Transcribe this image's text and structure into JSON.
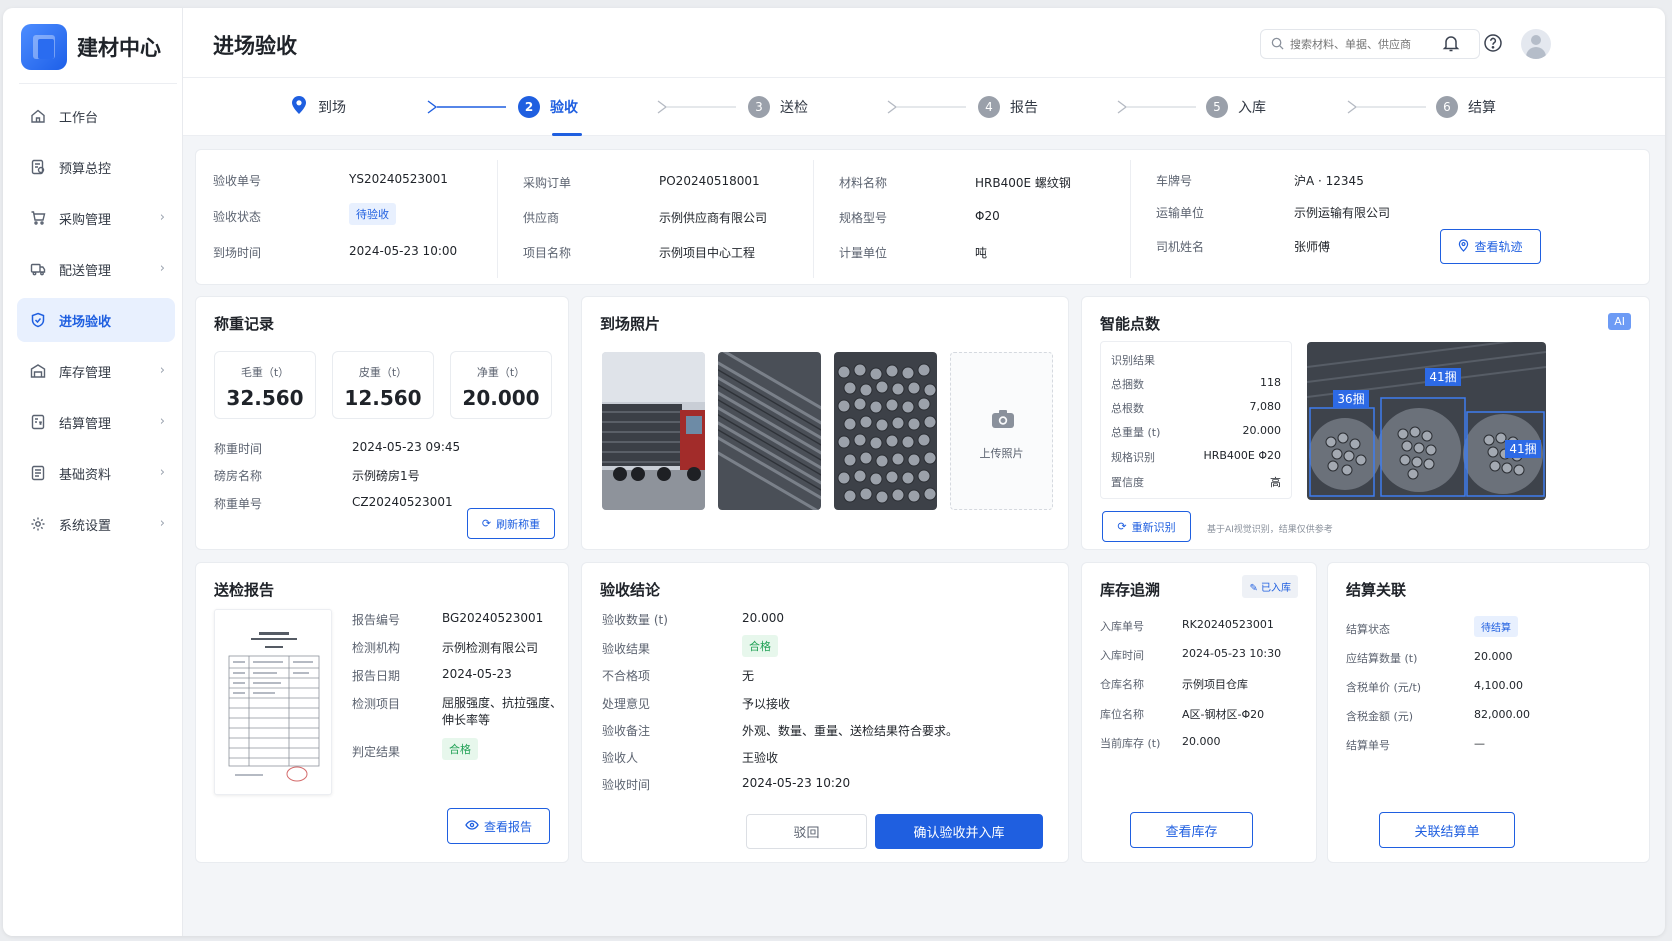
{
  "app": {
    "name": "建材中心"
  },
  "sidebar": {
    "items": [
      {
        "label": "工作台",
        "icon": "home-icon"
      },
      {
        "label": "预算总控",
        "icon": "budget-icon"
      },
      {
        "label": "采购管理",
        "icon": "cart-icon"
      },
      {
        "label": "配送管理",
        "icon": "truck-icon"
      },
      {
        "label": "进场验收",
        "icon": "shield-check-icon"
      },
      {
        "label": "库存管理",
        "icon": "warehouse-icon"
      },
      {
        "label": "结算管理",
        "icon": "settlement-icon"
      },
      {
        "label": "基础资料",
        "icon": "document-icon"
      },
      {
        "label": "系统设置",
        "icon": "gear-icon"
      }
    ]
  },
  "header": {
    "title": "进场验收",
    "search_placeholder": "搜索材料、单据、供应商"
  },
  "steps": [
    {
      "num": "",
      "label": "到场"
    },
    {
      "num": "2",
      "label": "验收"
    },
    {
      "num": "3",
      "label": "送检"
    },
    {
      "num": "4",
      "label": "报告"
    },
    {
      "num": "5",
      "label": "入库"
    },
    {
      "num": "6",
      "label": "结算"
    }
  ],
  "summary": {
    "col1": [
      {
        "k": "验收单号",
        "v": "YS20240523001"
      },
      {
        "k": "验收状态",
        "v": "待验收"
      },
      {
        "k": "到场时间",
        "v": "2024-05-23 10:00"
      }
    ],
    "col2": [
      {
        "k": "采购订单",
        "v": "PO20240518001"
      },
      {
        "k": "供应商",
        "v": "示例供应商有限公司"
      },
      {
        "k": "项目名称",
        "v": "示例项目中心工程"
      }
    ],
    "col3": [
      {
        "k": "材料名称",
        "v": "HRB400E 螺纹钢"
      },
      {
        "k": "规格型号",
        "v": "Φ20"
      },
      {
        "k": "计量单位",
        "v": "吨"
      }
    ],
    "col4": [
      {
        "k": "车牌号",
        "v": "沪A · 12345"
      },
      {
        "k": "运输单位",
        "v": "示例运输有限公司"
      },
      {
        "k": "司机姓名",
        "v": "张师傅"
      }
    ],
    "track_button": "查看轨迹"
  },
  "weighing": {
    "title": "称重记录",
    "boxes": [
      {
        "label": "毛重（t）",
        "value": "32.560"
      },
      {
        "label": "皮重（t）",
        "value": "12.560"
      },
      {
        "label": "净重（t）",
        "value": "20.000"
      }
    ],
    "rows": [
      {
        "k": "称重时间",
        "v": "2024-05-23 09:45"
      },
      {
        "k": "磅房名称",
        "v": "示例磅房1号"
      },
      {
        "k": "称重单号",
        "v": "CZ20240523001"
      }
    ],
    "refresh_button": "刷新称重"
  },
  "photos": {
    "title": "到场照片",
    "upload_label": "上传照片"
  },
  "ai_count": {
    "title": "智能点数",
    "badge": "AI",
    "result_title": "识别结果",
    "rows": [
      {
        "k": "总捆数",
        "v": "118"
      },
      {
        "k": "总根数",
        "v": "7,080"
      },
      {
        "k": "总重量 (t)",
        "v": "20.000"
      },
      {
        "k": "规格识别",
        "v": "HRB400E Φ20"
      },
      {
        "k": "置信度",
        "v": "高"
      }
    ],
    "boxes": [
      "36捆",
      "41捆",
      "41捆"
    ],
    "rerun_button": "重新识别",
    "note": "基于AI视觉识别，结果仅供参考"
  },
  "report": {
    "title": "送检报告",
    "rows": [
      {
        "k": "报告编号",
        "v": "BG20240523001"
      },
      {
        "k": "检测机构",
        "v": "示例检测有限公司"
      },
      {
        "k": "报告日期",
        "v": "2024-05-23"
      },
      {
        "k": "检测项目",
        "v": "屈服强度、抗拉强度、伸长率等"
      },
      {
        "k": "判定结果",
        "v": "合格"
      }
    ],
    "view_button": "查看报告"
  },
  "conclusion": {
    "title": "验收结论",
    "rows": [
      {
        "k": "验收数量 (t)",
        "v": "20.000"
      },
      {
        "k": "验收结果",
        "v": "合格"
      },
      {
        "k": "不合格项",
        "v": "无"
      },
      {
        "k": "处理意见",
        "v": "予以接收"
      },
      {
        "k": "验收备注",
        "v": "外观、数量、重量、送检结果符合要求。"
      },
      {
        "k": "验收人",
        "v": "王验收"
      },
      {
        "k": "验收时间",
        "v": "2024-05-23 10:20"
      }
    ],
    "reject_button": "驳回",
    "confirm_button": "确认验收并入库"
  },
  "inventory": {
    "title": "库存追溯",
    "badge": "已入库",
    "rows": [
      {
        "k": "入库单号",
        "v": "RK20240523001"
      },
      {
        "k": "入库时间",
        "v": "2024-05-23 10:30"
      },
      {
        "k": "仓库名称",
        "v": "示例项目仓库"
      },
      {
        "k": "库位名称",
        "v": "A区-钢材区-Φ20"
      },
      {
        "k": "当前库存 (t)",
        "v": "20.000"
      }
    ],
    "view_button": "查看库存"
  },
  "settlement": {
    "title": "结算关联",
    "rows": [
      {
        "k": "结算状态",
        "v": "待结算"
      },
      {
        "k": "应结算数量 (t)",
        "v": "20.000"
      },
      {
        "k": "含税单价 (元/t)",
        "v": "4,100.00"
      },
      {
        "k": "含税金额 (元)",
        "v": "82,000.00"
      },
      {
        "k": "结算单号",
        "v": "—"
      }
    ],
    "link_button": "关联结算单"
  },
  "colors": {
    "accent": "#1f5fe0",
    "success": "#22a156"
  }
}
